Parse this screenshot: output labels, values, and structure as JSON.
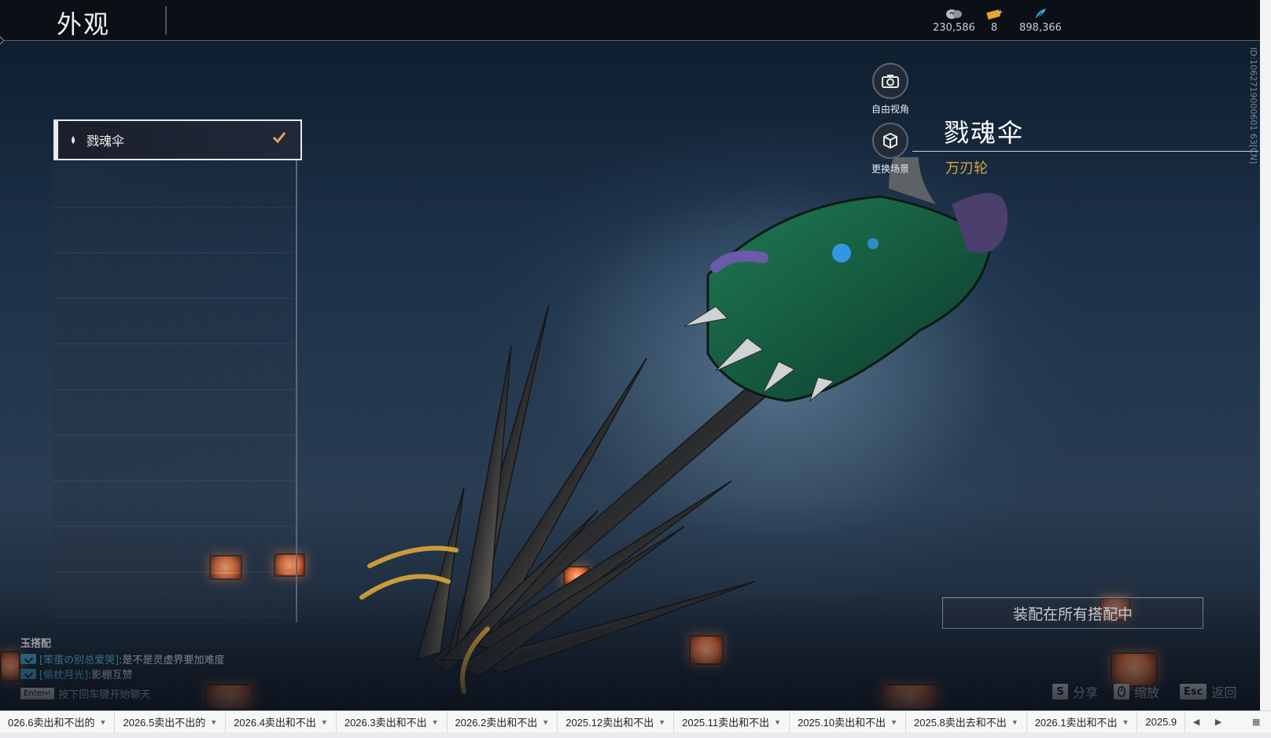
{
  "header": {
    "title": "外观",
    "currencies": [
      {
        "icon": "spiral-coin-icon",
        "value": "230,586"
      },
      {
        "icon": "ticket-icon",
        "value": "8"
      },
      {
        "icon": "feather-icon",
        "value": "898,366"
      }
    ]
  },
  "side_id": "ID:1062719000601 63[CN]",
  "list": {
    "items": [
      {
        "label": "戮魂伞",
        "selected": true
      }
    ]
  },
  "buttons": {
    "free_view": "自由视角",
    "change_scene": "更换场景"
  },
  "item": {
    "name": "戮魂伞",
    "subtitle": "万刃轮"
  },
  "equip_button": "装配在所有搭配中",
  "chat": {
    "header": "玉搭配",
    "lines": [
      {
        "user": "[笨蛋の别总爱哭]",
        "text": ":是不是灵虚界要加难度"
      },
      {
        "user": "[偷枕月光]",
        "text": ":影棚互赞"
      }
    ],
    "enter_key": "Enter↵",
    "hint": "按下回车键开始聊天"
  },
  "keys": [
    {
      "key": "S",
      "label": "分享"
    },
    {
      "key": "",
      "label": "缩放"
    },
    {
      "key": "Esc",
      "label": "返回"
    }
  ],
  "tabs": [
    "026.6卖出和不出的",
    "2026.5卖出不出的",
    "2026.4卖出和不出",
    "2026.3卖出和不出",
    "2026.2卖出和不出",
    "2025.12卖出和不出",
    "2025.11卖出和不出",
    "2025.10卖出和不出",
    "2025.8卖出去和不出",
    "2026.1卖出和不出",
    "2025.9"
  ]
}
